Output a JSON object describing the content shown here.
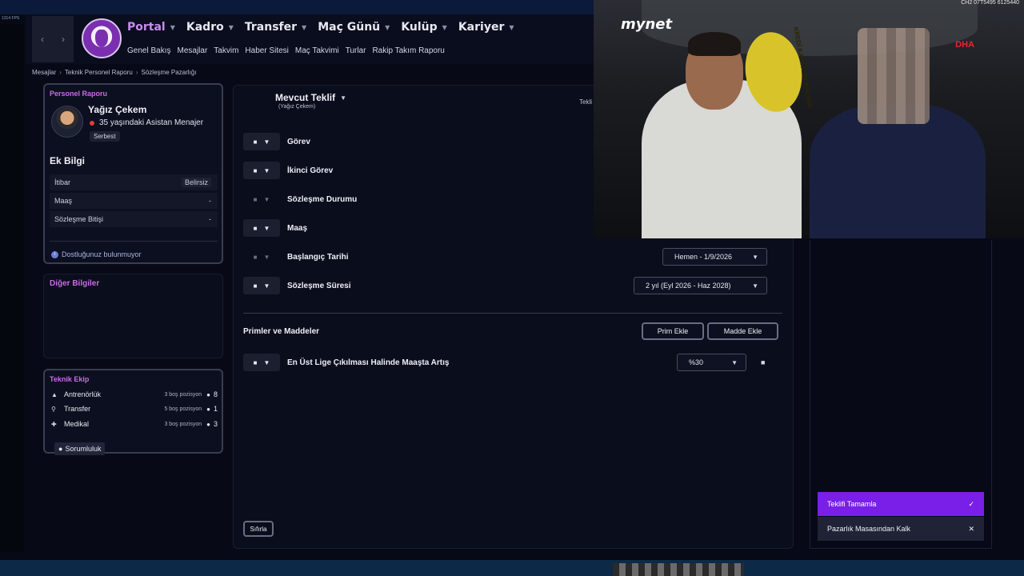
{
  "fps": "1314 FPS",
  "topbar": {
    "nav": [
      {
        "label": "Portal",
        "active": true
      },
      {
        "label": "Kadro",
        "active": false
      },
      {
        "label": "Transfer",
        "active": false
      },
      {
        "label": "Maç Günü",
        "active": false
      },
      {
        "label": "Kulüp",
        "active": false
      },
      {
        "label": "Kariyer",
        "active": false
      }
    ],
    "subnav": [
      "Genel Bakış",
      "Mesajlar",
      "Takvim",
      "Haber Sitesi",
      "Maç Takvimi",
      "Turlar",
      "Rakip Takım Raporu"
    ]
  },
  "breadcrumb": [
    "Mesajlar",
    "Teknik Personel Raporu",
    "Sözleşme Pazarlığı"
  ],
  "personel": {
    "section_label": "Personel Raporu",
    "name": "Yağız Çekem",
    "role": "35 yaşındaki Asistan Menajer",
    "status": "Serbest",
    "ek_bilgi_title": "Ek Bilgi",
    "rows": [
      {
        "label": "İtibar",
        "value": "Belirsiz"
      },
      {
        "label": "Maaş",
        "value": "-"
      },
      {
        "label": "Sözleşme Bitişi",
        "value": "-"
      }
    ],
    "friendship": "Dostluğunuz bulunmuyor"
  },
  "diger_bilgiler": "Diğer Bilgiler",
  "teknik_ekip": {
    "title": "Teknik Ekip",
    "rows": [
      {
        "icon": "whistle-icon",
        "label": "Antrenörlük",
        "positions": "3 boş pozisyon",
        "count": "8"
      },
      {
        "icon": "magnifier-icon",
        "label": "Transfer",
        "positions": "5 boş pozisyon",
        "count": "1"
      },
      {
        "icon": "medical-plus-icon",
        "label": "Medikal",
        "positions": "3 boş pozisyon",
        "count": "3"
      }
    ],
    "responsibility_button": "Sorumluluk"
  },
  "offer": {
    "title": "Mevcut Teklif",
    "subtitle": "(Yağız Çekem)",
    "right_label": "Tekli",
    "terms": [
      {
        "label": "Görev",
        "locked": true
      },
      {
        "label": "İkinci Görev",
        "locked": true
      },
      {
        "label": "Sözleşme Durumu",
        "locked": false
      },
      {
        "label": "Maaş",
        "locked": true
      },
      {
        "label": "Başlangıç Tarihi",
        "locked": false
      },
      {
        "label": "Sözleşme Süresi",
        "locked": true
      }
    ],
    "start_date_value": "Hemen - 1/9/2026",
    "duration_value": "2 yıl (Eyl 2026 - Haz 2028)",
    "bonuses_title": "Primler ve Maddeler",
    "add_bonus": "Prim Ekle",
    "add_clause": "Madde Ekle",
    "clause_label": "En Üst Lige Çıkılması Halinde Maaşta Artış",
    "clause_value": "%30",
    "reset": "Sıfırla"
  },
  "actions": {
    "complete": "Teklifi Tamamla",
    "leave": "Pazarlık Masasından Kalk"
  },
  "video": {
    "logo": "mynet",
    "corner": "CH2 07T5495 6125440",
    "watermark": "DHA",
    "cab_sign": "KREDİ KARTI GEÇERLİDİR"
  },
  "colors": {
    "accent_purple": "#7a1fe8",
    "label_pink": "#c96be8",
    "active_nav": "#c88cf2"
  }
}
